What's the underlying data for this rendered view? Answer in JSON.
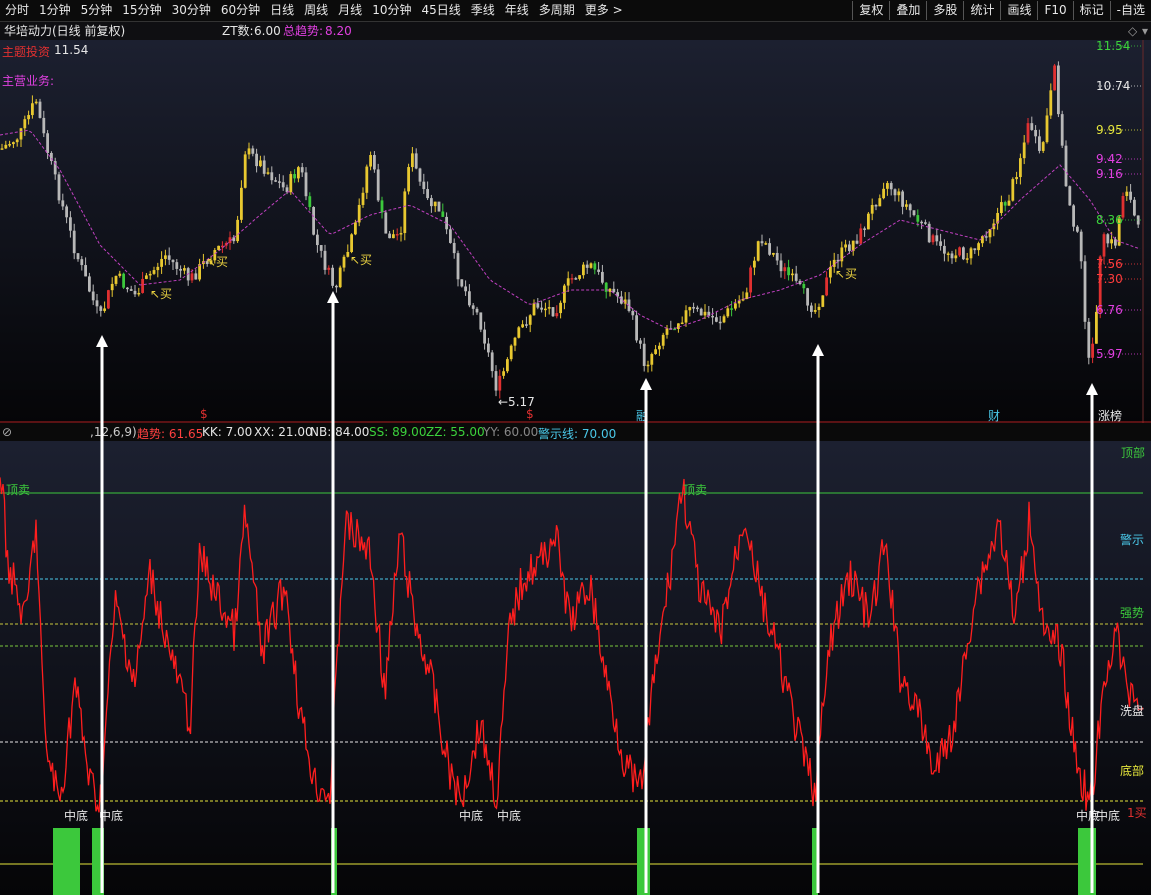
{
  "toolbar": {
    "tabs": [
      "分时",
      "1分钟",
      "5分钟",
      "15分钟",
      "30分钟",
      "60分钟",
      "日线",
      "周线",
      "月线",
      "10分钟",
      "45日线",
      "季线",
      "年线",
      "多周期",
      "更多 >"
    ],
    "right_buttons": [
      "复权",
      "叠加",
      "多股",
      "统计",
      "画线",
      "F10",
      "标记",
      "-自选"
    ]
  },
  "title": {
    "stock": "华培动力(日线 前复权)",
    "zt_label": "ZT数:",
    "zt_value": "6.00",
    "trend_label": "总趋势:",
    "trend_value": "8.20",
    "theme_label": "主题投资",
    "theme_price": "11.54",
    "business_label": "主营业务:"
  },
  "price_axis": [
    {
      "value": "11.54",
      "color": "#3cd23c"
    },
    {
      "value": "10.74",
      "color": "#e6e6e6"
    },
    {
      "value": "9.95",
      "color": "#e6e63c"
    },
    {
      "value": "9.42",
      "color": "#e040e0"
    },
    {
      "value": "9.16",
      "color": "#e040e0"
    },
    {
      "value": "8.36",
      "color": "#3cd23c"
    },
    {
      "value": "7.56",
      "color": "#ff3c3c"
    },
    {
      "value": "7.30",
      "color": "#ff3c3c"
    },
    {
      "value": "6.76",
      "color": "#e040e0"
    },
    {
      "value": "5.97",
      "color": "#e040e0"
    }
  ],
  "annotations": {
    "buy": "买",
    "low_price": "←5.17",
    "markers": [
      "$",
      "$",
      "融",
      "财",
      "涨榜"
    ]
  },
  "indicator_header": {
    "params": ",12,6,9)",
    "items": [
      {
        "label": "趋势:",
        "value": "61.65",
        "color": "#ff4040"
      },
      {
        "label": "KK:",
        "value": "7.00",
        "color": "#e6e6e6"
      },
      {
        "label": "XX:",
        "value": "21.00",
        "color": "#e6e6e6"
      },
      {
        "label": "NB:",
        "value": "84.00",
        "color": "#e6e6e6"
      },
      {
        "label": "SS:",
        "value": "89.00",
        "color": "#3cd23c"
      },
      {
        "label": "ZZ:",
        "value": "55.00",
        "color": "#3cd23c"
      },
      {
        "label": "YY:",
        "value": "60.00",
        "color": "#888888"
      },
      {
        "label": "警示线:",
        "value": "70.00",
        "color": "#4ac8e8"
      }
    ]
  },
  "indicator_levels": {
    "top": "顶部",
    "top_sell": "顶卖",
    "warn": "警示",
    "strong": "强势",
    "wash": "洗盘",
    "bottom": "底部",
    "mid_bottom": "中底",
    "buy1": "1买"
  },
  "colors": {
    "up": "#ff3030",
    "down": "#d0d0d0",
    "ma": "#d040d0",
    "indicator": "#ff2020",
    "signal": "#3cc83c"
  }
}
